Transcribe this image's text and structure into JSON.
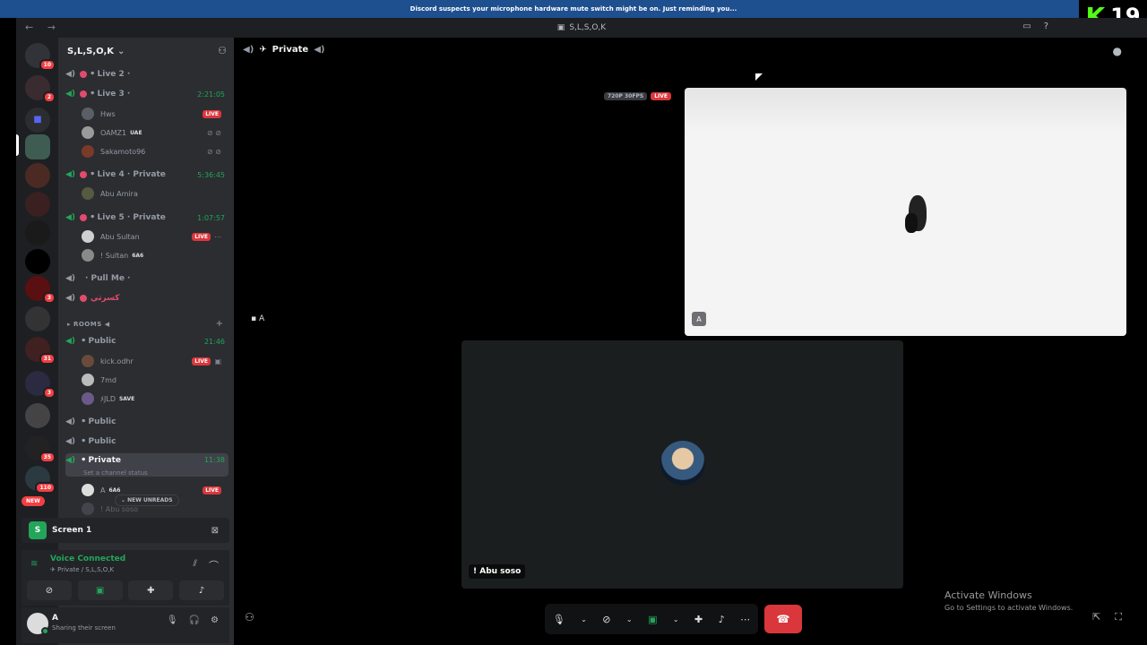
{
  "notice": "Discord suspects your microphone hardware mute switch might be on. Just reminding you...",
  "overlay": {
    "letter": "K",
    "number": "19"
  },
  "window": {
    "title": "S,L,S,O,K",
    "nav": "← →"
  },
  "server_rail": [
    {
      "badge": "10"
    },
    {
      "badge": "2"
    },
    {
      "badge": ""
    },
    {
      "badge": ""
    },
    {
      "badge": ""
    },
    {
      "badge": ""
    },
    {
      "badge": ""
    },
    {
      "badge": ""
    },
    {
      "badge": "3"
    },
    {
      "badge": ""
    },
    {
      "badge": "31"
    },
    {
      "badge": "3"
    },
    {
      "badge": ""
    },
    {
      "badge": "35"
    },
    {
      "badge": "110"
    },
    {
      "badge": "NEW"
    }
  ],
  "server": {
    "name": "S,L,S,O,K"
  },
  "channels": {
    "live2": "ꔷ Live 2 ·",
    "live3": "ꔷ Live 3 ·",
    "live3_time": "2:21:05",
    "live4": "ꔷ Live 4 · Private",
    "live4_time": "5:36:45",
    "live5": "ꔷ Live 5 · Private",
    "live5_time": "1:07:57",
    "pull": "· Pull Me ·",
    "emoji_ch": "كسرتي",
    "rooms_cat": "ROOMS ◀",
    "public1": "ꔷ Public",
    "public1_time": "21:46",
    "public2": "ꔷ Public",
    "public3": "ꔷ Public",
    "private": "ꔷ Private",
    "private_time": "11:38",
    "private_status": "Set a channel status"
  },
  "users": {
    "hws": "Hws",
    "oamz": "OAMZ1",
    "oamz_tag": "UAE",
    "saka": "Sakamoto96",
    "abuamira": "Abu Amira",
    "abusultan": "Abu Sultan",
    "sultan": "! Sultan",
    "sultan_tag": "6A6",
    "kick": "kick.odhr",
    "7md": "7md",
    "vjld": "ﾒJLD",
    "vjld_tag": "SAVE",
    "a": "A",
    "a_tag": "6A6",
    "abusoso_short": "! Abu soso"
  },
  "live_label": "LIVE",
  "new_unreads": "NEW UNREADS",
  "screen": {
    "label": "Screen 1"
  },
  "voice": {
    "status": "Voice Connected",
    "location": "Private / S,L,S,O,K"
  },
  "user_panel": {
    "name": "A",
    "status": "Sharing their screen"
  },
  "stage": {
    "channel": "Private",
    "quality": "720P 30FPS",
    "live": "LIVE",
    "tile1_tag": "A",
    "side_label": "A",
    "tile2_name": "! Abu soso"
  },
  "activate": {
    "title": "Activate Windows",
    "subtitle": "Go to Settings to activate Windows."
  }
}
